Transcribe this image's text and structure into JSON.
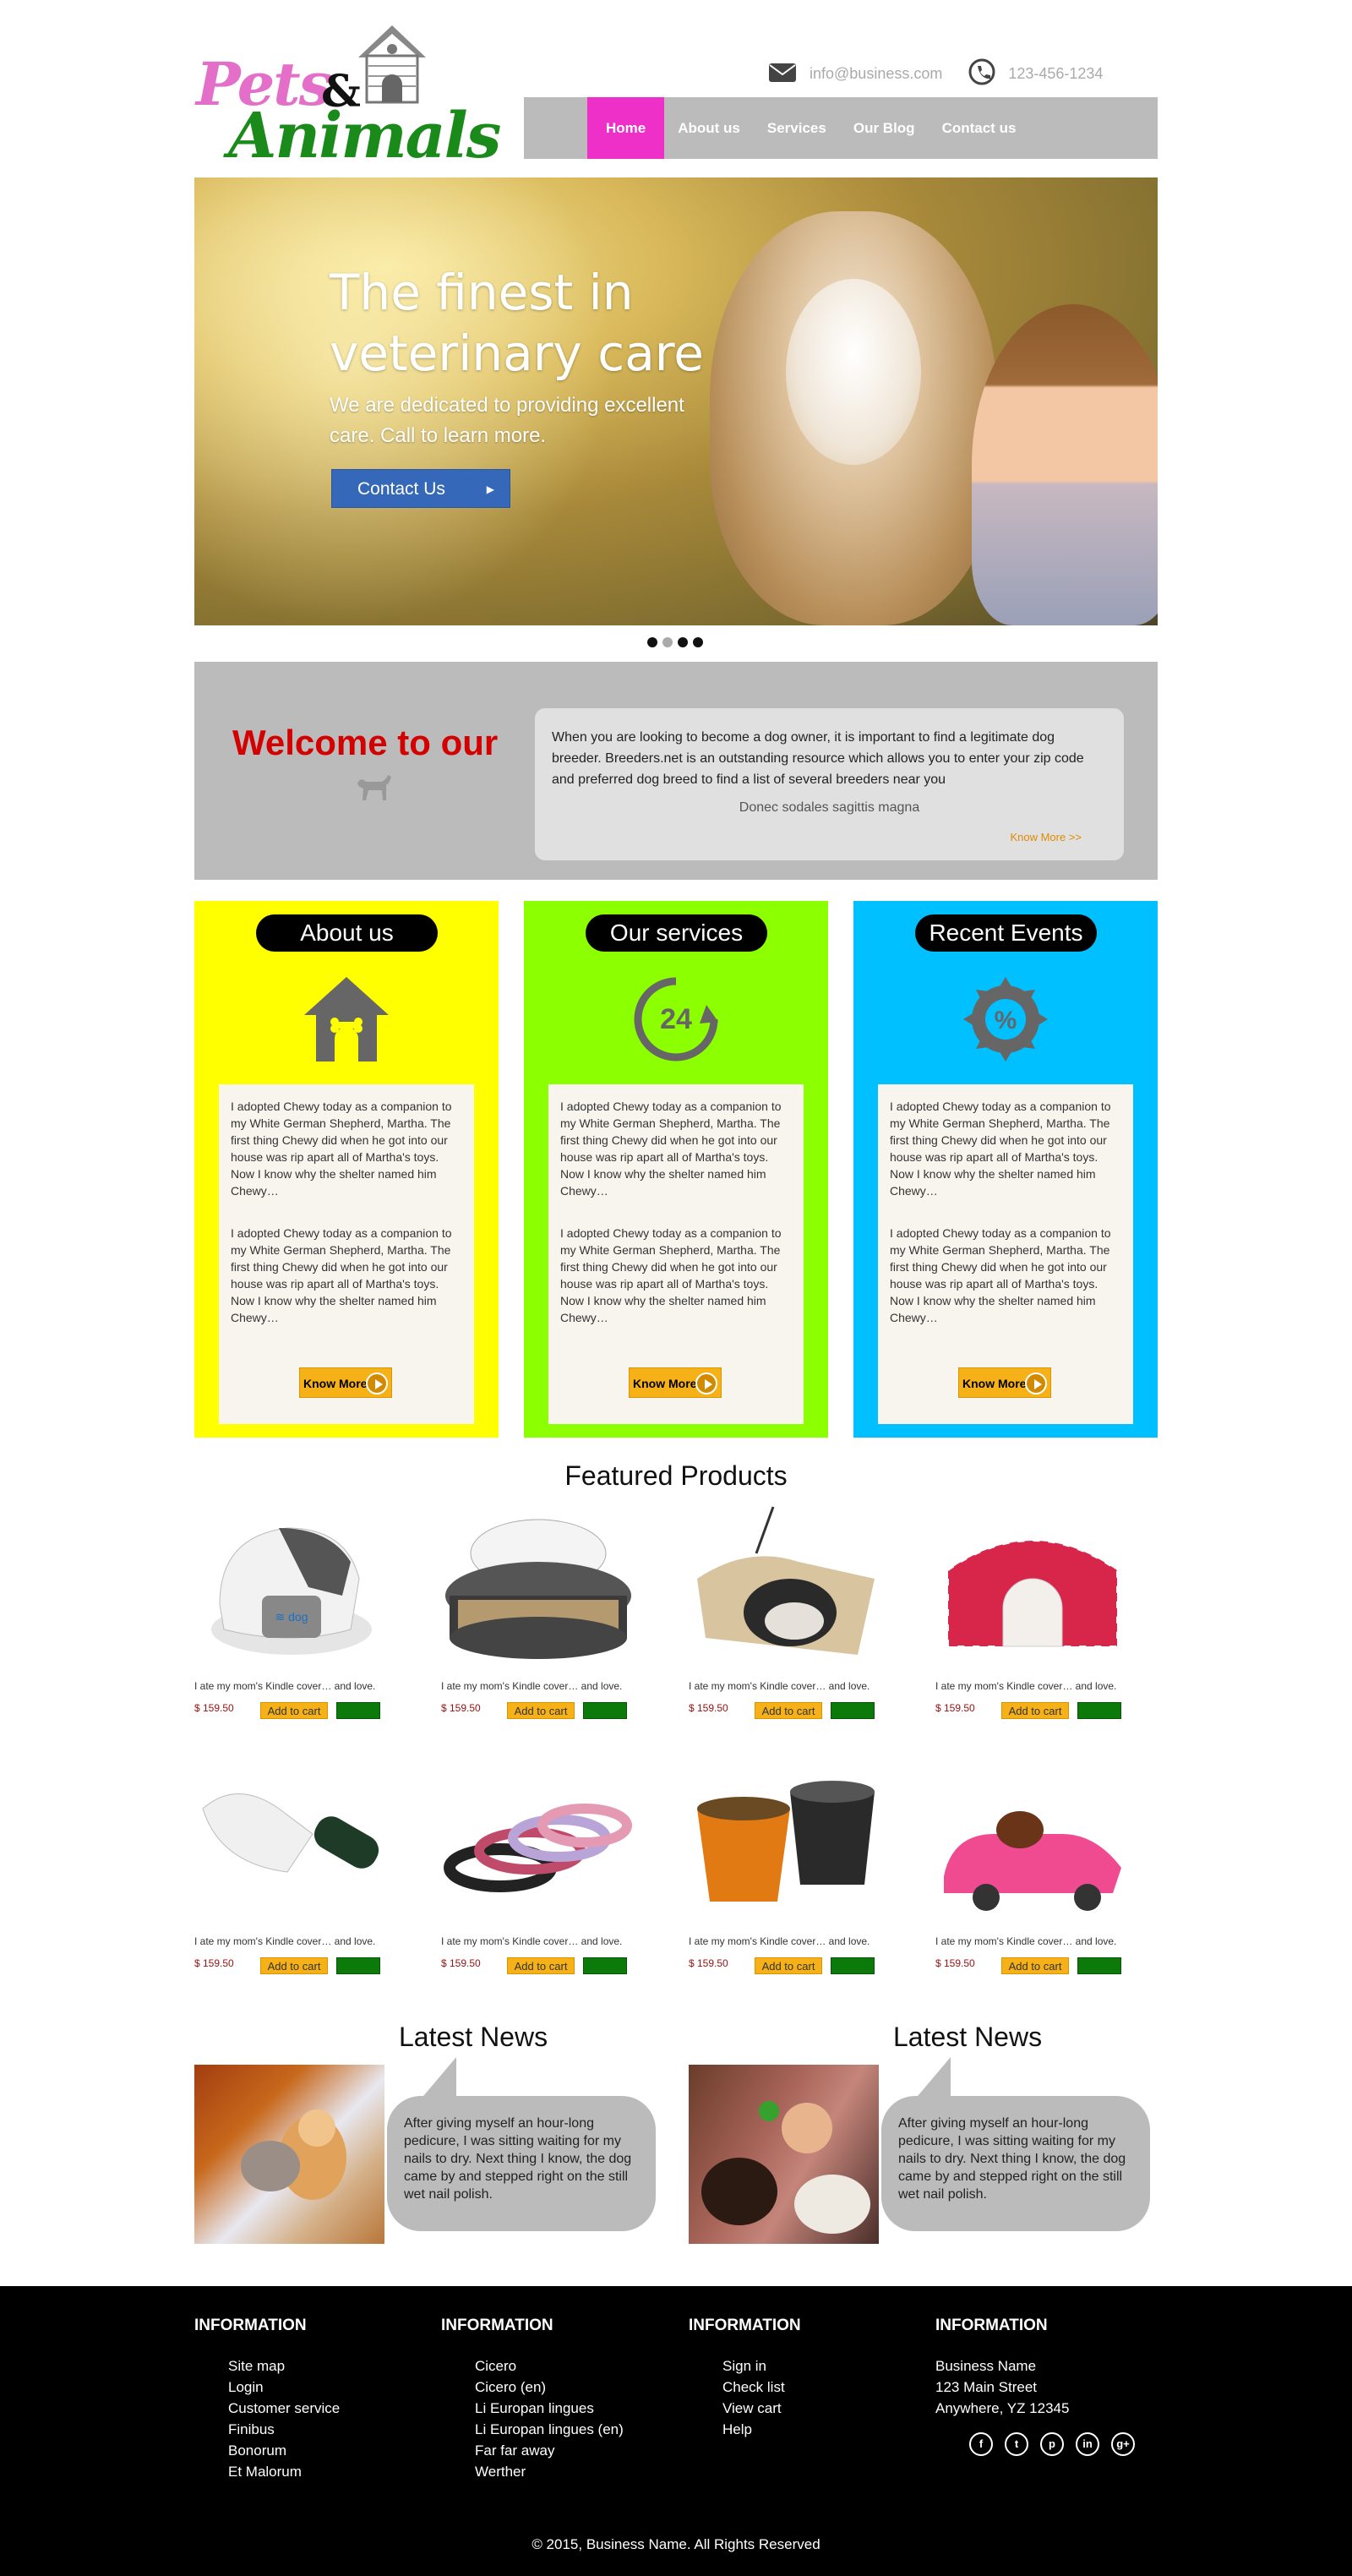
{
  "brand": {
    "word1": "Pets",
    "amp": "&",
    "word2": "Animals"
  },
  "top_contact": {
    "email": "info@business.com",
    "phone": "123-456-1234"
  },
  "nav": {
    "items": [
      "Home",
      "About us",
      "Services",
      "Our Blog",
      "Contact us"
    ],
    "active": "Home"
  },
  "hero": {
    "title": "The finest in veterinary care",
    "text": "We are dedicated to providing excellent care. Call to learn more.",
    "button": "Contact Us",
    "slides": 4,
    "active_slide": 2
  },
  "welcome": {
    "title": "Welcome to our",
    "text": "When you are looking to become a dog owner, it is important to find a legitimate dog breeder. Breeders.net is an outstanding resource which allows you to enter your zip code and preferred dog breed to find a list of several breeders near you",
    "subtitle": "Donec sodales sagittis magna",
    "link": "Know More >>"
  },
  "feature_cols": [
    {
      "title": "About us",
      "color": "#ffff00",
      "icon": "dog-house-icon",
      "paragraphs": [
        "I adopted Chewy today as a companion to my White German Shepherd, Martha. The first thing Chewy did when he got into our house was rip apart all of Martha's toys. Now I know why the shelter named him Chewy…",
        "I adopted Chewy today as a companion to my White German Shepherd, Martha. The first thing Chewy did when he got into our house was rip apart all of Martha's toys. Now I know why the shelter named him Chewy…"
      ],
      "button": "Know More"
    },
    {
      "title": "Our services",
      "color": "#8cff00",
      "icon": "clock-24-icon",
      "paragraphs": [
        "I adopted Chewy today as a companion to my White German Shepherd, Martha. The first thing Chewy did when he got into our house was rip apart all of Martha's toys. Now I know why the shelter named him Chewy…",
        "I adopted Chewy today as a companion to my White German Shepherd, Martha. The first thing Chewy did when he got into our house was rip apart all of Martha's toys. Now I know why the shelter named him Chewy…"
      ],
      "button": "Know More"
    },
    {
      "title": "Recent Events",
      "color": "#00c0ff",
      "icon": "percent-badge-icon",
      "paragraphs": [
        "I adopted Chewy today as a companion to my White German Shepherd, Martha. The first thing Chewy did when he got into our house was rip apart all of Martha's toys. Now I know why the shelter named him Chewy…",
        "I adopted Chewy today as a companion to my White German Shepherd, Martha. The first thing Chewy did when he got into our house was rip apart all of Martha's toys. Now I know why the shelter named him Chewy…"
      ],
      "button": "Know More"
    }
  ],
  "products": {
    "title": "Featured Products",
    "items": [
      {
        "desc": "I ate my mom's Kindle cover… and love.",
        "price": "$ 159.50",
        "add": "Add to cart",
        "image": "pet-feeder"
      },
      {
        "desc": "I ate my mom's Kindle cover… and love.",
        "price": "$ 159.50",
        "add": "Add to cart",
        "image": "fish-habitat"
      },
      {
        "desc": "I ate my mom's Kindle cover… and love.",
        "price": "$ 159.50",
        "add": "Add to cart",
        "image": "cat-bed"
      },
      {
        "desc": "I ate my mom's Kindle cover… and love.",
        "price": "$ 159.50",
        "add": "Add to cart",
        "image": "pet-carrier"
      },
      {
        "desc": "I ate my mom's Kindle cover… and love.",
        "price": "$ 159.50",
        "add": "Add to cart",
        "image": "pet-brush"
      },
      {
        "desc": "I ate my mom's Kindle cover… and love.",
        "price": "$ 159.50",
        "add": "Add to cart",
        "image": "pet-collars"
      },
      {
        "desc": "I ate my mom's Kindle cover… and love.",
        "price": "$ 159.50",
        "add": "Add to cart",
        "image": "pet-bowls"
      },
      {
        "desc": "I ate my mom's Kindle cover… and love.",
        "price": "$ 159.50",
        "add": "Add to cart",
        "image": "car-pet-bed"
      }
    ]
  },
  "news": [
    {
      "title": "Latest News",
      "text": "After giving myself an hour-long pedicure, I was sitting waiting for my nails to dry. Next thing I know, the dog came by and stepped right on the still wet nail polish."
    },
    {
      "title": "Latest News",
      "text": "After giving myself an hour-long pedicure, I was sitting waiting for my nails to dry. Next thing I know, the dog came by and stepped right on the still wet nail polish."
    }
  ],
  "footer": {
    "cols": [
      {
        "title": "INFORMATION",
        "items": [
          "Site map",
          "Login",
          "Customer service",
          "Finibus",
          "Bonorum",
          "Et Malorum"
        ]
      },
      {
        "title": "INFORMATION",
        "items": [
          "Cicero",
          "Cicero (en)",
          "Li Europan lingues",
          "Li Europan lingues (en)",
          "Far far away",
          "Werther"
        ]
      },
      {
        "title": "INFORMATION",
        "items": [
          "Sign in",
          "Check list",
          "View cart",
          "Help"
        ]
      },
      {
        "title": "INFORMATION",
        "items": [
          "Business Name",
          "123 Main Street",
          "Anywhere, YZ 12345"
        ]
      }
    ],
    "social": [
      {
        "name": "facebook-icon",
        "glyph": "f"
      },
      {
        "name": "twitter-icon",
        "glyph": "t"
      },
      {
        "name": "pinterest-icon",
        "glyph": "p"
      },
      {
        "name": "linkedin-icon",
        "glyph": "in"
      },
      {
        "name": "googleplus-icon",
        "glyph": "g+"
      }
    ],
    "copyright": "© 2015, Business Name. All Rights Reserved"
  }
}
